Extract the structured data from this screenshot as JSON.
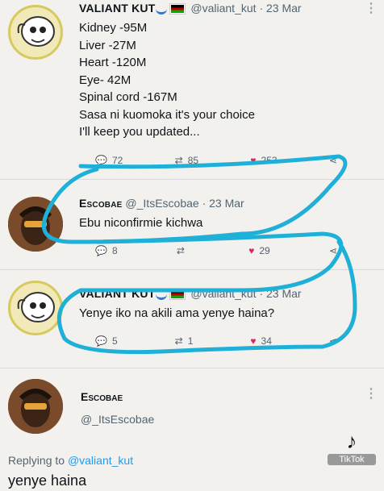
{
  "tweets": [
    {
      "name": "VALIANT KUT",
      "handle": "@valiant_kut",
      "date": "· 23 Mar",
      "lines": [
        "Kidney -95M",
        "Liver -27M",
        "Heart -120M",
        "Eye- 42M",
        "Spinal cord -167M",
        "Sasa ni kuomoka it's your choice",
        "I'll keep you updated..."
      ],
      "stats": {
        "replies": "72",
        "retweets": "85",
        "likes": "253"
      }
    },
    {
      "name": "Escobae",
      "handle": "@_ItsEscobae",
      "date": "· 23 Mar",
      "lines": [
        "Ebu niconfirmie kichwa"
      ],
      "stats": {
        "replies": "8",
        "retweets": "",
        "likes": "29"
      }
    },
    {
      "name": "VALIANT KUT",
      "handle": "@valiant_kut",
      "date": "· 23 Mar",
      "lines": [
        "Yenye iko na akili ama yenye haina?"
      ],
      "stats": {
        "replies": "5",
        "retweets": "1",
        "likes": "34"
      }
    },
    {
      "name": "Escobae",
      "handle": "@_ItsEscobae"
    }
  ],
  "replying_to": {
    "prefix": "Replying to",
    "mention": "@valiant_kut"
  },
  "reply_text": "yenye haina",
  "watermark": {
    "brand": "TikTok"
  },
  "icons": {
    "reply": "reply-icon",
    "retweet": "retweet-icon",
    "like": "heart-icon",
    "share": "share-icon",
    "more": "more-icon"
  },
  "colors": {
    "annotation": "#1fb0d8",
    "like": "#e0245e",
    "handle": "#536471",
    "mention": "#1d9bf0"
  }
}
